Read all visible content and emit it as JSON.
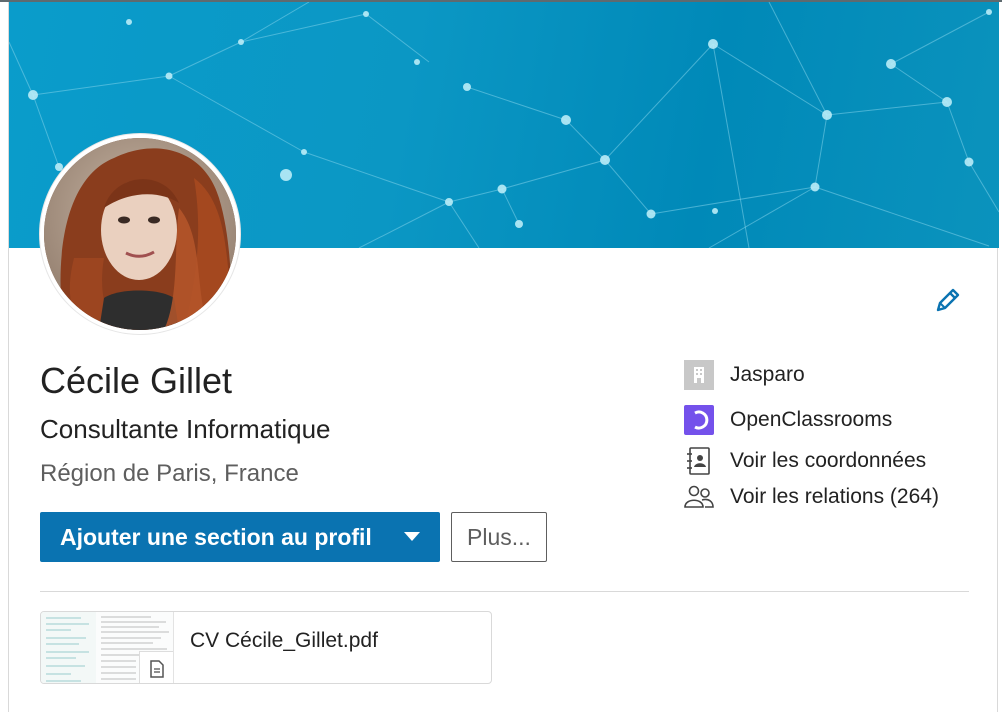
{
  "profile": {
    "name": "Cécile Gillet",
    "headline": "Consultante Informatique",
    "location": "Région de Paris, France"
  },
  "actions": {
    "add_section_label": "Ajouter une section au profil",
    "more_label": "Plus..."
  },
  "sidebar": {
    "items": [
      {
        "label": "Jasparo",
        "icon": "company-building-icon"
      },
      {
        "label": "OpenClassrooms",
        "icon": "openclassrooms-logo-icon"
      },
      {
        "label": "Voir les coordonnées",
        "icon": "contact-book-icon"
      },
      {
        "label": "Voir les relations (264)",
        "icon": "people-icon"
      }
    ]
  },
  "document": {
    "filename": "CV Cécile_Gillet.pdf",
    "icon": "document-icon"
  },
  "colors": {
    "primary_button": "#0a73b1",
    "banner": "#0a9ccb",
    "openclassrooms": "#7451eb",
    "edit_icon": "#0a73b1"
  }
}
